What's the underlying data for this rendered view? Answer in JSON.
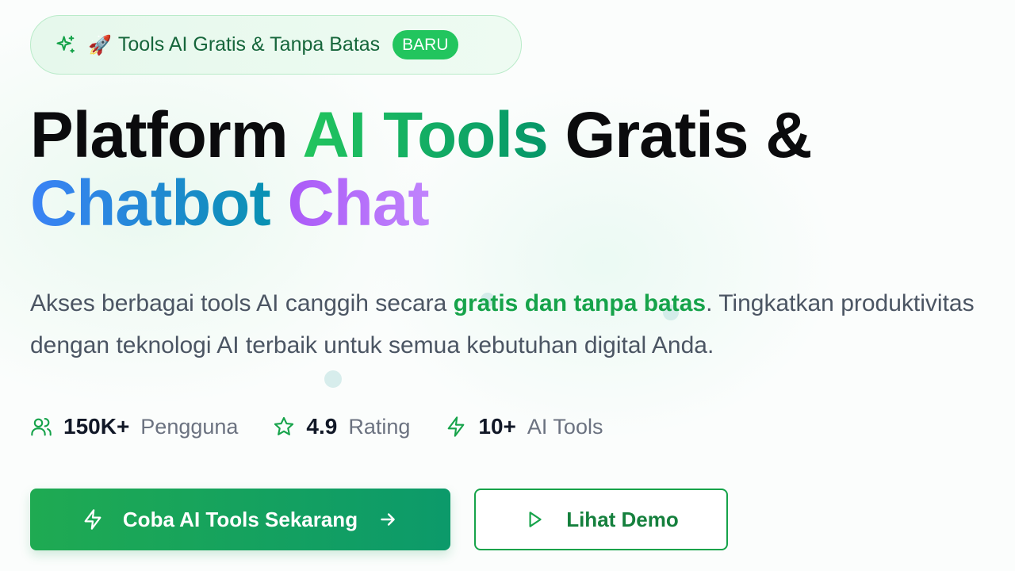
{
  "badge": {
    "icon": "sparkles-icon",
    "emoji": "🚀",
    "text": "Tools AI Gratis & Tanpa Batas",
    "pill": "BARU"
  },
  "hero": {
    "title_part1": "Platform ",
    "title_part2": "AI Tools",
    "title_part3": " Gratis &",
    "title_part4": "Chatbot",
    "title_part5": " Chat",
    "desc_part1": "Akses berbagai tools AI canggih secara ",
    "desc_highlight": "gratis dan tanpa batas",
    "desc_part2": ". Tingkatkan produktivitas dengan teknologi AI terbaik untuk semua kebutuhan digital Anda."
  },
  "stats": [
    {
      "icon": "users-icon",
      "value": "150K+",
      "label": "Pengguna"
    },
    {
      "icon": "star-icon",
      "value": "4.9",
      "label": "Rating"
    },
    {
      "icon": "zap-icon",
      "value": "10+",
      "label": "AI Tools"
    }
  ],
  "buttons": {
    "primary_label": "Coba AI Tools Sekarang",
    "primary_icon": "zap-icon",
    "primary_trailing_icon": "arrow-right-icon",
    "secondary_label": "Lihat Demo",
    "secondary_icon": "play-icon"
  },
  "colors": {
    "accent_green": "#22c55e",
    "dark_green": "#16a34a",
    "blue": "#3b82f6",
    "purple": "#a855f7"
  }
}
